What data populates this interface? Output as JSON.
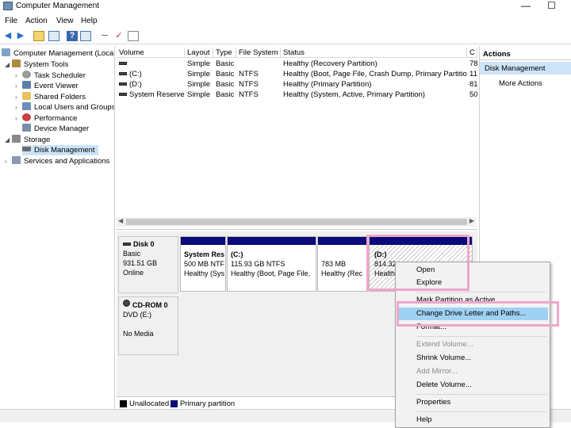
{
  "window": {
    "title": "Computer Management"
  },
  "menu": [
    "File",
    "Action",
    "View",
    "Help"
  ],
  "tree": {
    "root": "Computer Management (Local",
    "system_tools": "System Tools",
    "items": [
      "Task Scheduler",
      "Event Viewer",
      "Shared Folders",
      "Local Users and Groups",
      "Performance",
      "Device Manager"
    ],
    "storage": "Storage",
    "disk_management": "Disk Management",
    "services": "Services and Applications"
  },
  "volume_list": {
    "headers": [
      "Volume",
      "Layout",
      "Type",
      "File System",
      "Status",
      "C"
    ],
    "rows": [
      {
        "volume": "",
        "layout": "Simple",
        "type": "Basic",
        "fs": "",
        "status": "Healthy (Recovery Partition)",
        "cap": "78"
      },
      {
        "volume": "(C:)",
        "layout": "Simple",
        "type": "Basic",
        "fs": "NTFS",
        "status": "Healthy (Boot, Page File, Crash Dump, Primary Partition)",
        "cap": "11"
      },
      {
        "volume": "(D:)",
        "layout": "Simple",
        "type": "Basic",
        "fs": "NTFS",
        "status": "Healthy (Primary Partition)",
        "cap": "81"
      },
      {
        "volume": "System Reserved",
        "layout": "Simple",
        "type": "Basic",
        "fs": "NTFS",
        "status": "Healthy (System, Active, Primary Partition)",
        "cap": "50"
      }
    ]
  },
  "disk0": {
    "name": "Disk 0",
    "type": "Basic",
    "size": "931.51 GB",
    "state": "Online",
    "partitions": [
      {
        "name": "System Res",
        "detail": "500 MB NTF",
        "status": "Healthy (Sys"
      },
      {
        "name": "(C:)",
        "detail": "115.93 GB NTFS",
        "status": "Healthy (Boot, Page File,"
      },
      {
        "name": "",
        "detail": "783 MB",
        "status": "Healthy (Rec"
      },
      {
        "name": "(D:)",
        "detail": "814.32",
        "status": "Health"
      }
    ]
  },
  "cdrom0": {
    "name": "CD-ROM 0",
    "type": "DVD (E:)",
    "state": "No Media"
  },
  "legend": {
    "unallocated": "Unallocated",
    "primary": "Primary partition",
    "unallocated_color": "#000000",
    "primary_color": "#0a0a7a"
  },
  "actions": {
    "header": "Actions",
    "selected": "Disk Management",
    "more": "More Actions"
  },
  "context_menu": {
    "open": "Open",
    "explore": "Explore",
    "mark_active": "Mark Partition as Active",
    "change_letter": "Change Drive Letter and Paths...",
    "format": "Format...",
    "extend": "Extend Volume...",
    "shrink": "Shrink Volume...",
    "add_mirror": "Add Mirror...",
    "delete": "Delete Volume...",
    "properties": "Properties",
    "help": "Help"
  }
}
